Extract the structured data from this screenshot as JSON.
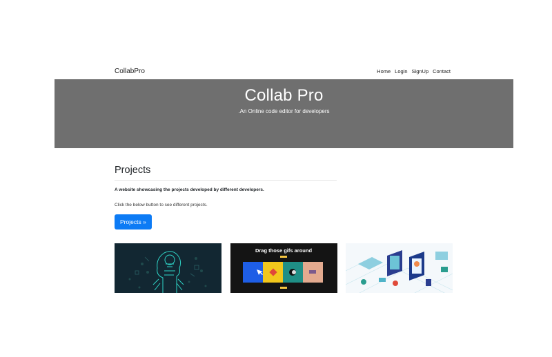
{
  "navbar": {
    "brand": "CollabPro",
    "links": [
      "Home",
      "Login",
      "SignUp",
      "Contact"
    ]
  },
  "hero": {
    "title": "Collab Pro",
    "subtitle": ".An Online code editor for developers",
    "background": "#6f6f6f"
  },
  "projects": {
    "heading": "Projects",
    "lead": "A website showcasing the projects developed by different developers.",
    "description": "Click the below button to see different projects.",
    "button_label": "Projects »",
    "button_color": "#0d7bf5"
  },
  "cards": [
    {
      "icon": "ai-robot-head-illustration"
    },
    {
      "title": "Drag those gifs around",
      "icon": "gif-drag-illustration"
    },
    {
      "icon": "isometric-collaboration-illustration"
    }
  ]
}
